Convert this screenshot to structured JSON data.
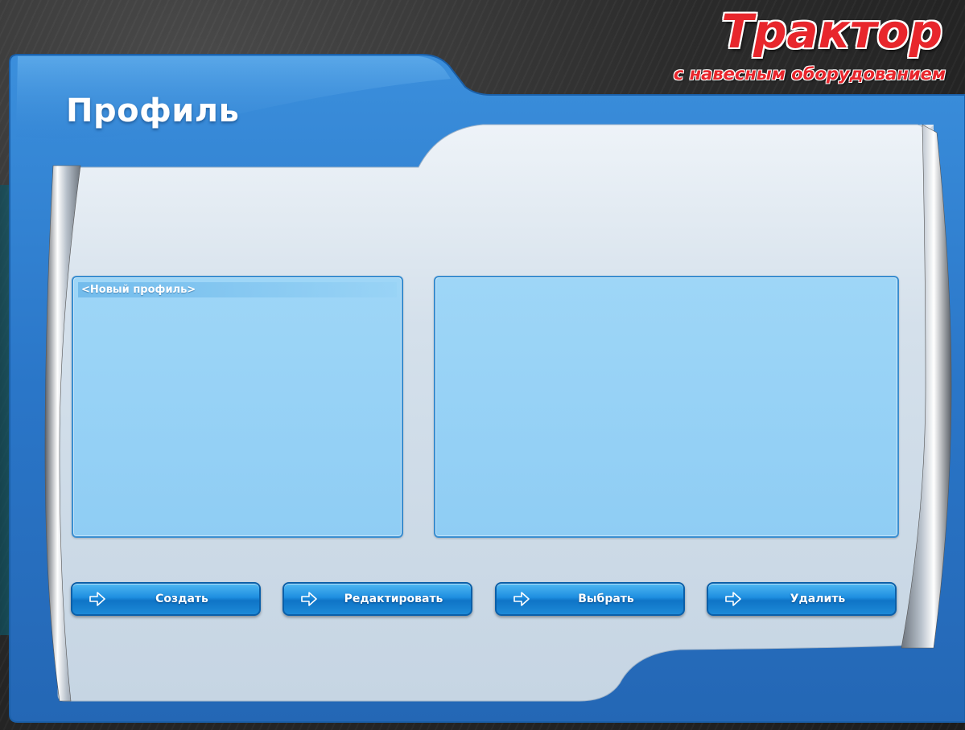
{
  "logo": {
    "title": "Трактор",
    "subtitle": "с навесным оборудованием"
  },
  "page": {
    "title": "Профиль"
  },
  "profiles": {
    "items": [
      "<Новый профиль>"
    ]
  },
  "buttons": {
    "create": "Создать",
    "edit": "Редактировать",
    "select": "Выбрать",
    "delete": "Удалить"
  },
  "icons": {
    "button_arrow": "arrow-right-outline-icon"
  },
  "colors": {
    "frame_blue": "#2f7fd0",
    "panel_blue": "#9ed6f7",
    "button_blue": "#1e8ee0",
    "logo_red": "#e8262c"
  }
}
